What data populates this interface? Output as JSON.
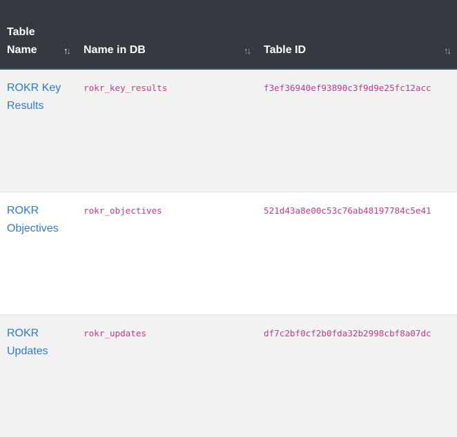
{
  "table": {
    "headers": [
      {
        "label": "Table Name",
        "sorted": true
      },
      {
        "label": "Name in DB",
        "sorted": false
      },
      {
        "label": "Table ID",
        "sorted": false
      }
    ],
    "sort_icon": {
      "up": "↑",
      "down": "↓"
    },
    "rows": [
      {
        "table_name": "ROKR Key Results",
        "name_in_db": "rokr_key_results",
        "table_id": "f3ef36940ef93890c3f9d9e25fc12acc"
      },
      {
        "table_name": "ROKR Objectives",
        "name_in_db": "rokr_objectives",
        "table_id": "521d43a8e00c53c76ab48197784c5e41"
      },
      {
        "table_name": "ROKR Updates",
        "name_in_db": "rokr_updates",
        "table_id": "df7c2bf0cf2b0fda32b2998cbf8a07dc"
      }
    ]
  },
  "colors": {
    "header_bg": "#343a40",
    "link": "#2a7bd6",
    "code": "#d63384",
    "row_stripe": "#f2f2f2"
  }
}
